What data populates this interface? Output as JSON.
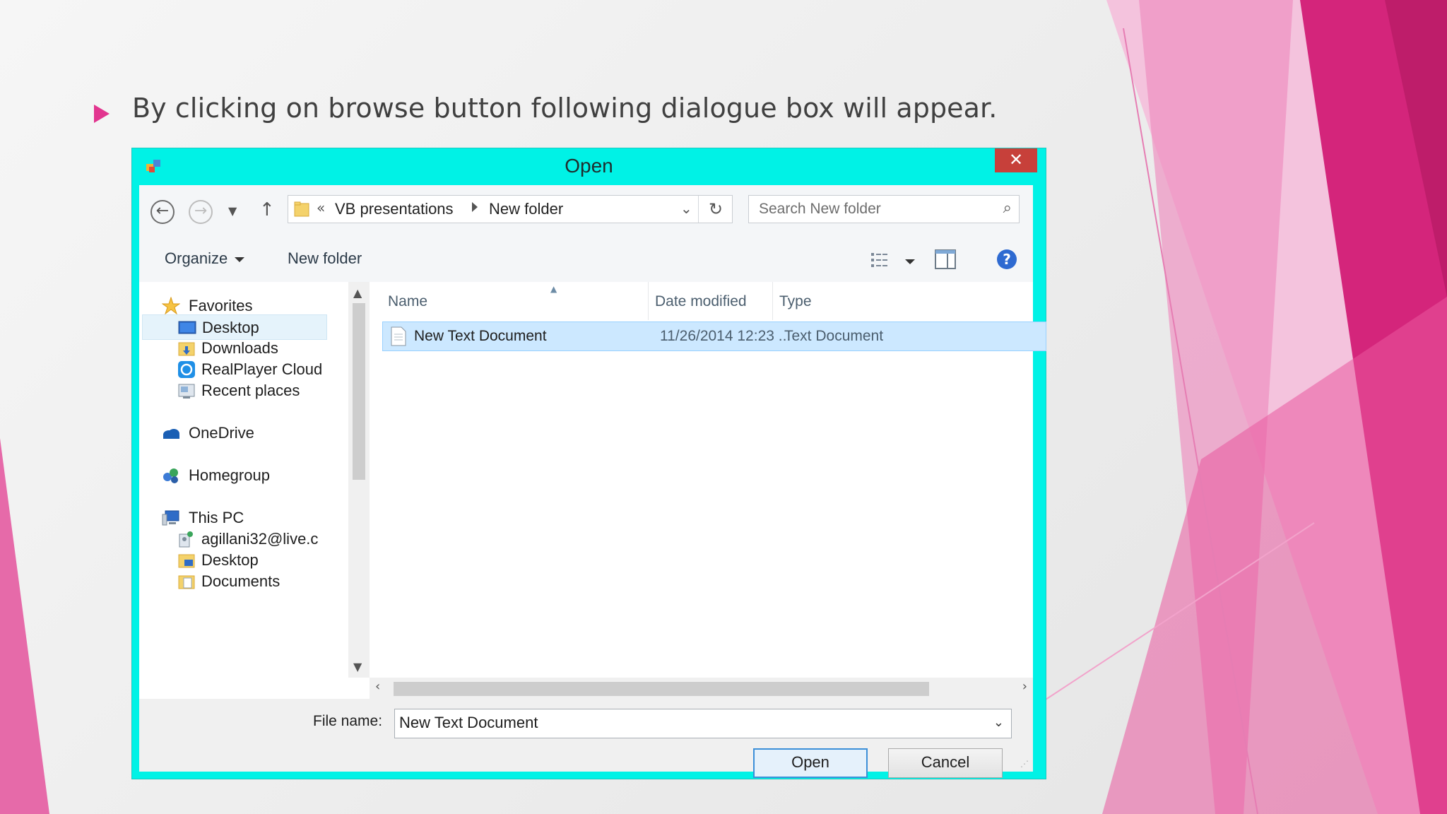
{
  "slide": {
    "bullet_text": "By clicking on browse button following dialogue box will appear."
  },
  "dialog": {
    "title": "Open",
    "close_glyph": "✕",
    "address": {
      "overflow_glyph": "«",
      "segments": [
        "VB presentations",
        "New folder"
      ]
    },
    "search": {
      "placeholder": "Search New folder"
    },
    "toolbar": {
      "organize_label": "Organize",
      "new_folder_label": "New folder"
    },
    "help_glyph": "?",
    "nav_pane": {
      "items": [
        {
          "label": "Favorites",
          "icon": "star-icon"
        },
        {
          "label": "Desktop",
          "icon": "desktop-icon",
          "selected": true
        },
        {
          "label": "Downloads",
          "icon": "downloads-folder-icon"
        },
        {
          "label": "RealPlayer Cloud",
          "icon": "realplayer-cloud-icon"
        },
        {
          "label": "Recent places",
          "icon": "recent-places-icon"
        },
        {
          "label": "OneDrive",
          "icon": "onedrive-icon"
        },
        {
          "label": "Homegroup",
          "icon": "homegroup-icon"
        },
        {
          "label": "This PC",
          "icon": "computer-icon"
        },
        {
          "label": "agillani32@live.c",
          "icon": "user-folder-icon"
        },
        {
          "label": "Desktop",
          "icon": "folder-icon"
        },
        {
          "label": "Documents",
          "icon": "documents-folder-icon"
        }
      ]
    },
    "file_list": {
      "columns": [
        "Name",
        "Date modified",
        "Type"
      ],
      "rows": [
        {
          "name": "New Text Document",
          "date": "11/26/2014 12:23 ...",
          "type": "Text Document"
        }
      ]
    },
    "file_name": {
      "label": "File name:",
      "value": "New Text Document"
    },
    "buttons": {
      "open": "Open",
      "cancel": "Cancel"
    },
    "colors": {
      "frame": "#00f2e6",
      "close": "#c7403a",
      "selection": "#cce8ff",
      "accent": "#e2358f"
    }
  }
}
